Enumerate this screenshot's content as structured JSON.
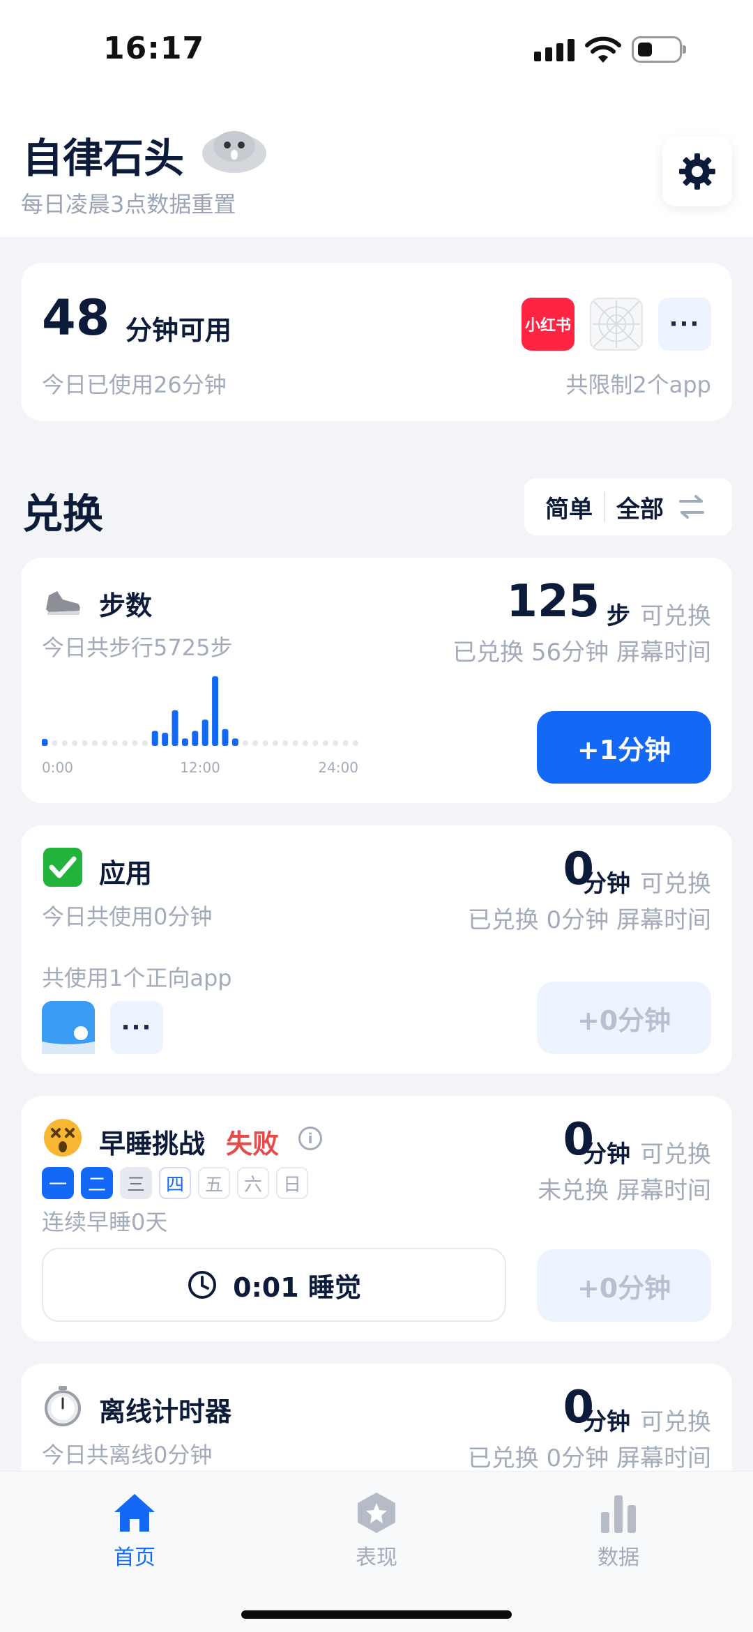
{
  "status_bar": {
    "time": "16:17"
  },
  "header": {
    "title": "自律石头",
    "subtitle": "每日凌晨3点数据重置"
  },
  "summary": {
    "available_minutes": "48",
    "available_label": "分钟可用",
    "used_today": "今日已使用26分钟",
    "limited_apps": "共限制2个app",
    "app_badge_label": "小红书",
    "more_label": "···"
  },
  "exchange": {
    "title": "兑换",
    "view_toggle": {
      "simple": "简单",
      "all": "全部"
    }
  },
  "steps_card": {
    "title": "步数",
    "subtitle": "今日共步行5725步",
    "value": "125",
    "unit": "步",
    "exchangeable": "可兑换",
    "exchanged": "已兑换 56分钟 屏幕时间",
    "button": "+1分钟",
    "chart_data": {
      "type": "bar",
      "x_labels": [
        "0:00",
        "12:00",
        "24:00"
      ],
      "values": [
        3,
        0,
        0,
        0,
        0,
        0,
        0,
        0,
        0,
        0,
        0,
        8,
        7,
        19,
        4,
        8,
        14,
        37,
        9,
        4,
        0,
        0,
        0,
        0,
        0,
        0,
        0,
        0,
        0,
        0,
        0,
        0
      ],
      "ylim": [
        0,
        40
      ]
    }
  },
  "apps_card": {
    "title": "应用",
    "subtitle": "今日共使用0分钟",
    "value": "0",
    "unit": "分钟",
    "exchangeable": "可兑换",
    "exchanged": "已兑换 0分钟 屏幕时间",
    "positive_apps": "共使用1个正向app",
    "more_label": "···",
    "button": "+0分钟"
  },
  "sleep_card": {
    "title": "早睡挑战",
    "status": "失败",
    "info_glyph": "i",
    "days": [
      "一",
      "二",
      "三",
      "四",
      "五",
      "六",
      "日"
    ],
    "streak": "连续早睡0天",
    "sleep_time": "0:01 睡觉",
    "value": "0",
    "unit": "分钟",
    "exchangeable": "可兑换",
    "exchanged": "未兑换 屏幕时间",
    "button": "+0分钟"
  },
  "offline_card": {
    "title": "离线计时器",
    "subtitle": "今日共离线0分钟",
    "value": "0",
    "unit": "分钟",
    "exchangeable": "可兑换",
    "exchanged": "已兑换 0分钟 屏幕时间"
  },
  "tabbar": {
    "tabs": [
      {
        "label": "首页",
        "icon": "home-icon",
        "active": true
      },
      {
        "label": "表现",
        "icon": "star-badge-icon",
        "active": false
      },
      {
        "label": "数据",
        "icon": "bar-chart-icon",
        "active": false
      }
    ]
  },
  "colors": {
    "accent": "#1369f5",
    "fail": "#e84a4a",
    "muted": "#a2abb9",
    "xhs": "#ff2442"
  }
}
